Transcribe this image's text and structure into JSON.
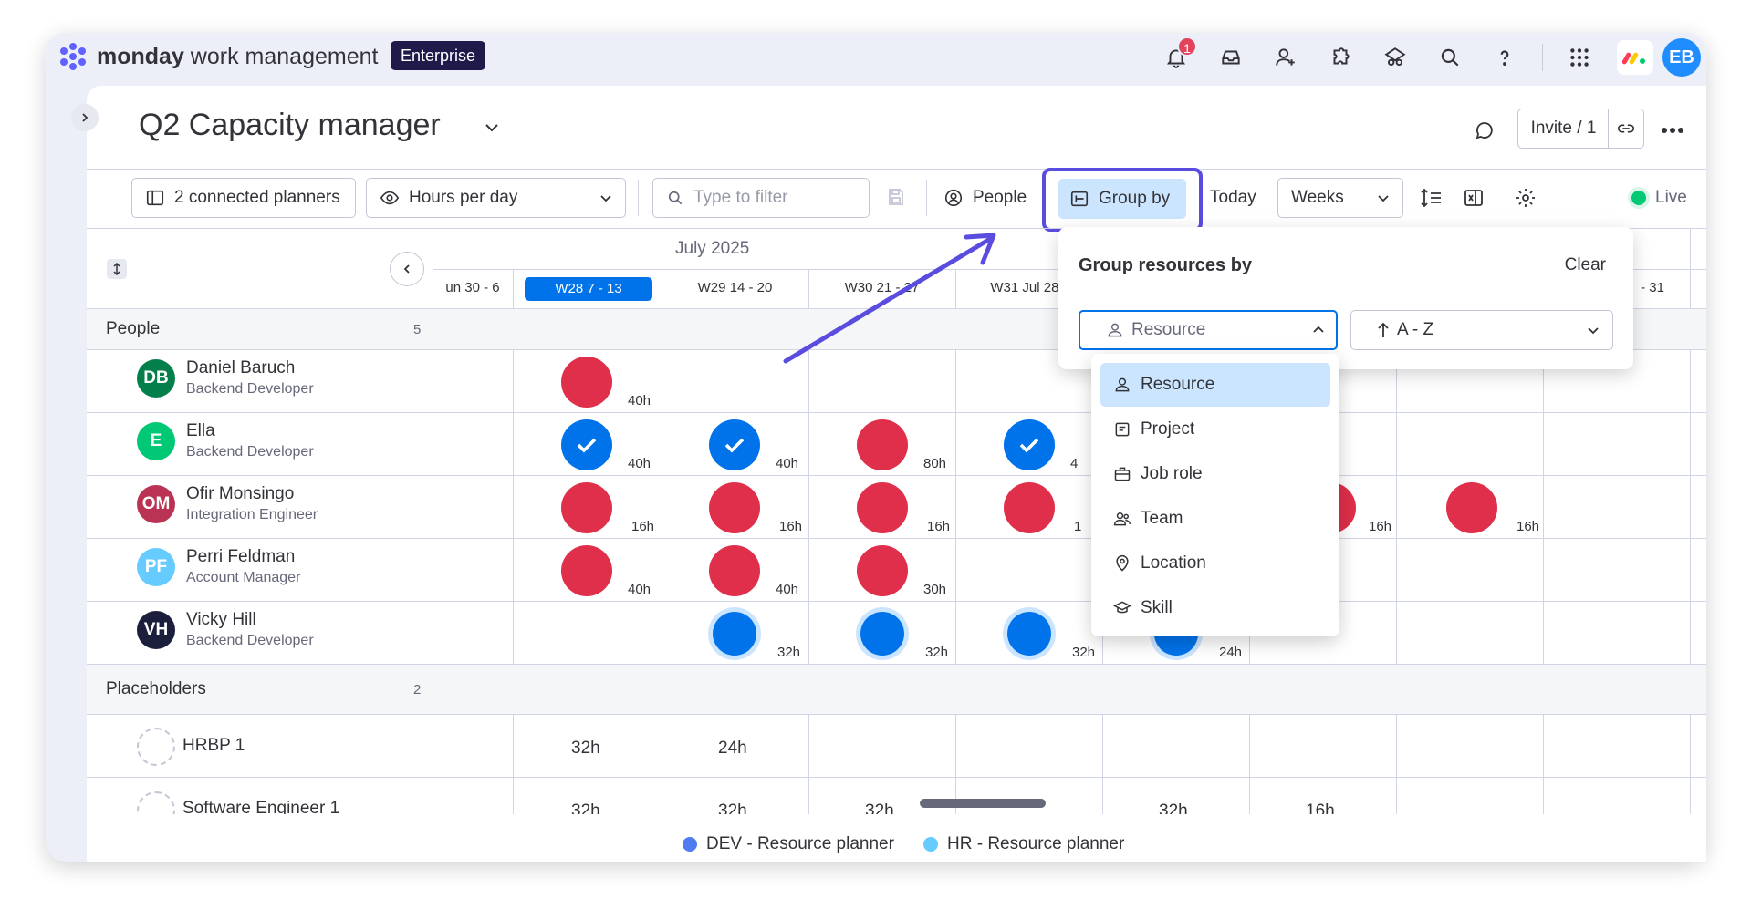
{
  "app": {
    "brand_bold": "monday",
    "brand_rest": " work management",
    "plan_badge": "Enterprise",
    "notification_count": "1",
    "user_initials": "EB"
  },
  "header": {
    "title": "Q2 Capacity manager",
    "invite_label": "Invite / 1"
  },
  "toolbar": {
    "connected_planners": "2 connected planners",
    "view_mode": "Hours per day",
    "filter_placeholder": "Type to filter",
    "people_label": "People",
    "group_by_label": "Group by",
    "today_label": "Today",
    "scale_label": "Weeks",
    "live_label": "Live"
  },
  "timeline": {
    "month": "July 2025",
    "weeks": [
      "un 30 - 6",
      "W28 7 - 13",
      "W29 14 - 20",
      "W30 21 - 27",
      "W31 Jul 28 -",
      "",
      "",
      "- 31"
    ]
  },
  "sections": {
    "people": {
      "label": "People",
      "count": "5"
    },
    "placeholders": {
      "label": "Placeholders",
      "count": "2"
    }
  },
  "people": [
    {
      "initials": "DB",
      "name": "Daniel Baruch",
      "role": "Backend Developer",
      "color": "#037f4c"
    },
    {
      "initials": "E",
      "name": "Ella",
      "role": "Backend Developer",
      "color": "#00c875"
    },
    {
      "initials": "OM",
      "name": "Ofir Monsingo",
      "role": "Integration Engineer",
      "color": "#bb3354"
    },
    {
      "initials": "PF",
      "name": "Perri Feldman",
      "role": "Account Manager",
      "color": "#66ccff"
    },
    {
      "initials": "VH",
      "name": "Vicky Hill",
      "role": "Backend Developer",
      "color": "#1c1f3b"
    }
  ],
  "allocations": {
    "daniel": [
      "40h"
    ],
    "ella": [
      "40h",
      "40h",
      "80h",
      "4"
    ],
    "ofir": [
      "16h",
      "16h",
      "16h",
      "1",
      "16h",
      "16h"
    ],
    "perri": [
      "40h",
      "40h",
      "30h"
    ],
    "vicky": [
      "32h",
      "32h",
      "32h",
      "24h"
    ]
  },
  "placeholders": [
    {
      "name": "HRBP 1",
      "hours": [
        "32h",
        "24h"
      ]
    },
    {
      "name": "Software Engineer 1",
      "hours": [
        "32h",
        "32h",
        "32h",
        "32h",
        "16h"
      ]
    }
  ],
  "legend": [
    {
      "label": "DEV - Resource planner",
      "color": "#4f7cf0"
    },
    {
      "label": "HR - Resource planner",
      "color": "#66ccff"
    }
  ],
  "group_popover": {
    "title": "Group resources by",
    "clear_label": "Clear",
    "selected_group": "Resource",
    "sort_label": "A - Z",
    "options": [
      {
        "label": "Resource",
        "icon": "person-icon"
      },
      {
        "label": "Project",
        "icon": "project-icon"
      },
      {
        "label": "Job role",
        "icon": "briefcase-icon"
      },
      {
        "label": "Team",
        "icon": "team-icon"
      },
      {
        "label": "Location",
        "icon": "location-pin-icon"
      },
      {
        "label": "Skill",
        "icon": "graduation-cap-icon"
      }
    ]
  }
}
